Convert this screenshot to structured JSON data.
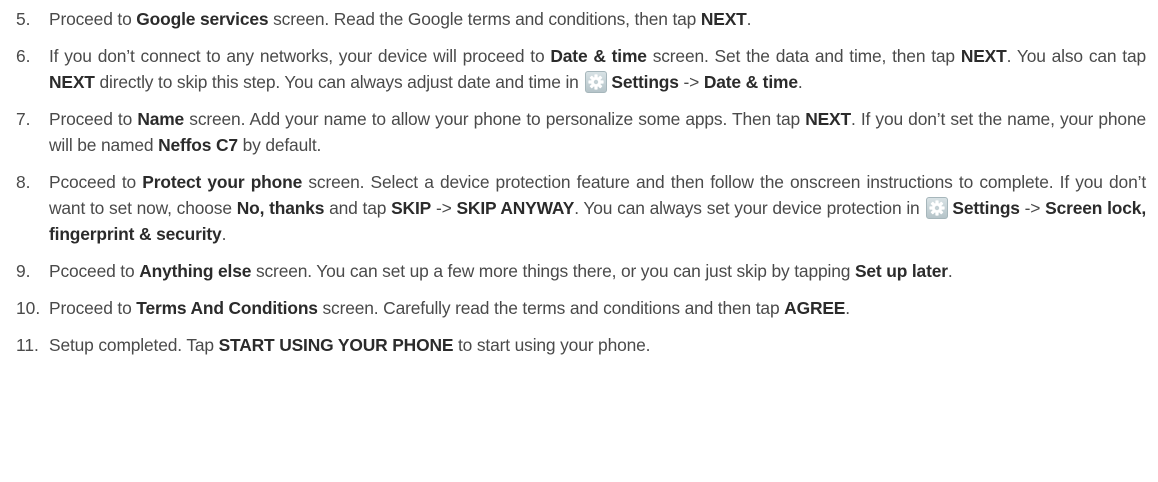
{
  "steps": [
    {
      "number": "5.",
      "parts": [
        {
          "t": "Proceed to "
        },
        {
          "b": "Google services"
        },
        {
          "t": " screen. Read the Google terms and conditions, then tap "
        },
        {
          "b": "NEXT"
        },
        {
          "t": "."
        }
      ]
    },
    {
      "number": "6.",
      "parts": [
        {
          "t": "If you don’t connect to any networks, your device will proceed to "
        },
        {
          "b": "Date & time"
        },
        {
          "t": " screen. Set the data and time, then tap "
        },
        {
          "b": "NEXT"
        },
        {
          "t": ". You also can tap "
        },
        {
          "b": "NEXT"
        },
        {
          "t": " directly to skip this step. You can always adjust date and time in "
        },
        {
          "icon": "gear-icon"
        },
        {
          "b": "Settings"
        },
        {
          "t": " -> "
        },
        {
          "b": "Date & time"
        },
        {
          "t": "."
        }
      ]
    },
    {
      "number": "7.",
      "parts": [
        {
          "t": "Proceed to "
        },
        {
          "b": "Name"
        },
        {
          "t": " screen. Add your name to allow your phone to personalize some apps. Then tap "
        },
        {
          "b": "NEXT"
        },
        {
          "t": ". If you don’t set the name, your phone will be named "
        },
        {
          "b": "Neffos C7"
        },
        {
          "t": " by default."
        }
      ]
    },
    {
      "number": "8.",
      "parts": [
        {
          "t": "Pcoceed to "
        },
        {
          "b": "Protect your phone"
        },
        {
          "t": " screen. Select a device protection feature and then follow the onscreen instructions to complete. If you don’t want to set now, choose "
        },
        {
          "b": "No, thanks"
        },
        {
          "t": " and tap "
        },
        {
          "b": "SKIP"
        },
        {
          "t": " -> "
        },
        {
          "b": "SKIP ANYWAY"
        },
        {
          "t": ". You can always set your device protection in "
        },
        {
          "icon": "gear-icon"
        },
        {
          "b": "Settings"
        },
        {
          "t": " -> "
        },
        {
          "b": "Screen lock, fingerprint & security"
        },
        {
          "t": "."
        }
      ]
    },
    {
      "number": "9.",
      "parts": [
        {
          "t": "Pcoceed to "
        },
        {
          "b": "Anything else"
        },
        {
          "t": " screen. You can set up a few more things there, or you can just skip by tapping "
        },
        {
          "b": "Set up later"
        },
        {
          "t": "."
        }
      ]
    },
    {
      "number": "10.",
      "parts": [
        {
          "t": "Proceed to "
        },
        {
          "b": "Terms And Conditions"
        },
        {
          "t": " screen. Carefully read the terms and conditions and then tap "
        },
        {
          "b": "AGREE"
        },
        {
          "t": "."
        }
      ]
    },
    {
      "number": "11.",
      "parts": [
        {
          "t": "Setup completed. Tap "
        },
        {
          "b": "START USING YOUR PHONE"
        },
        {
          "t": " to start using your phone."
        }
      ]
    }
  ]
}
